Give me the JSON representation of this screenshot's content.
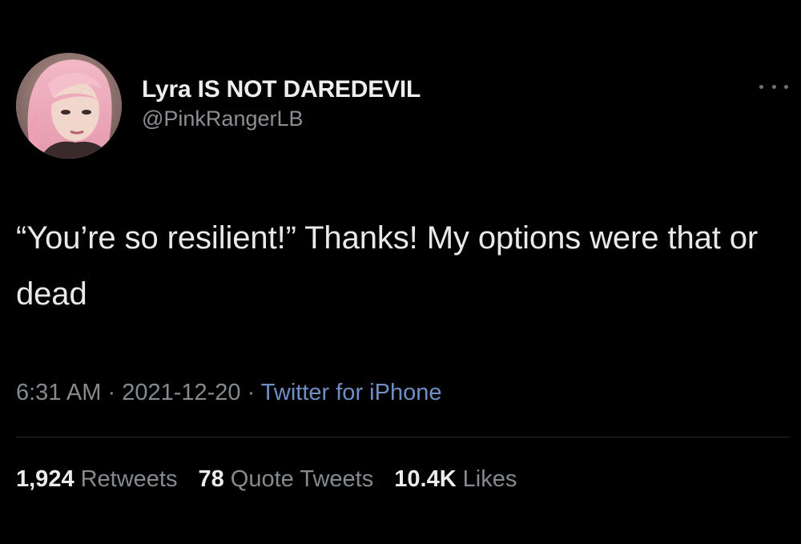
{
  "user": {
    "display_name": "Lyra IS NOT DAREDEVIL",
    "handle": "@PinkRangerLB",
    "avatar_icon": "profile-photo-pink-hair"
  },
  "more_icon": "ellipsis-icon",
  "tweet": {
    "text": "“You’re so resilient!” Thanks! My options were that or dead"
  },
  "meta": {
    "time": "6:31 AM",
    "separator": "·",
    "date": "2021-12-20",
    "source": "Twitter for iPhone"
  },
  "stats": {
    "retweets_count": "1,924",
    "retweets_label": "Retweets",
    "quotes_count": "78",
    "quotes_label": "Quote Tweets",
    "likes_count": "10.4K",
    "likes_label": "Likes"
  },
  "colors": {
    "background": "#000000",
    "text": "#e9e9e9",
    "secondary": "#858a8f",
    "link": "#6f8fc4"
  }
}
